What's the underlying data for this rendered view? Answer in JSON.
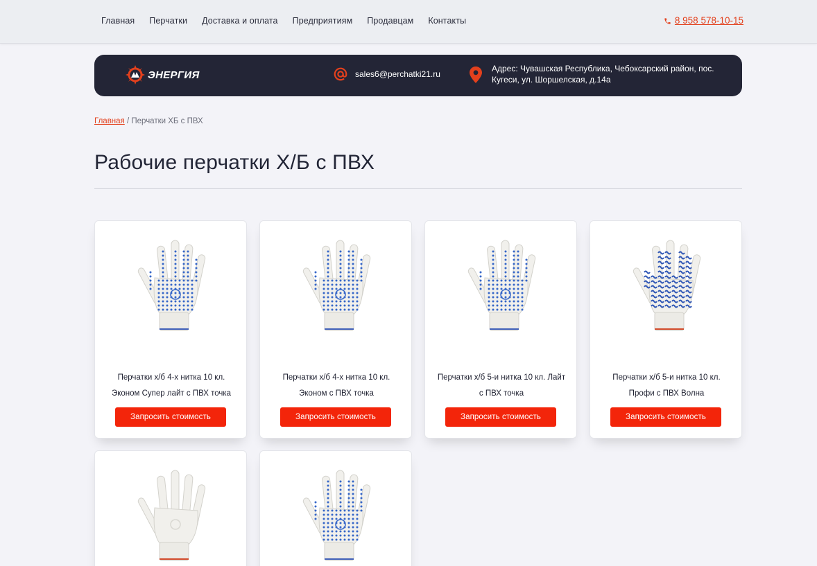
{
  "nav": {
    "items": [
      "Главная",
      "Перчатки",
      "Доставка и оплата",
      "Предприятиям",
      "Продавцам",
      "Контакты"
    ],
    "phone": "8 958 578-10-15",
    "phone_icon": "phone-icon"
  },
  "header": {
    "logo_text": "ЭНЕРГИЯ",
    "email": "sales6@perchatki21.ru",
    "email_icon": "at-sign-icon",
    "address": "Адрес: Чувашская Республика, Чебоксарский район, пос. Кугеси, ул. Шоршелская, д.14а",
    "address_icon": "location-pin-icon"
  },
  "breadcrumb": {
    "home": "Главная",
    "separator": "/",
    "current": "Перчатки ХБ с ПВХ"
  },
  "page": {
    "title": "Рабочие перчатки Х/Б с ПВХ"
  },
  "products": [
    {
      "name": "Перчатки х/б 4-х нитка 10 кл. Эконом Супер лайт с ПВХ точка",
      "button": "Запросить стоимость",
      "pattern": "dots-blue"
    },
    {
      "name": "Перчатки х/б 4-х нитка 10 кл. Эконом с ПВХ точка",
      "button": "Запросить стоимость",
      "pattern": "dots-blue"
    },
    {
      "name": "Перчатки х/б 5-и нитка 10 кл. Лайт с ПВХ точка",
      "button": "Запросить стоимость",
      "pattern": "dots-blue"
    },
    {
      "name": "Перчатки х/б 5-и нитка 10 кл. Профи с ПВХ Волна",
      "button": "Запросить стоимость",
      "pattern": "wave-blue"
    },
    {
      "name": "",
      "button": "",
      "pattern": "plain-white"
    },
    {
      "name": "",
      "button": "",
      "pattern": "dots-blue"
    }
  ],
  "colors": {
    "accent": "#f3250a",
    "link": "#e3401d",
    "header_band": "#232536",
    "page_bg": "#f3f3f8"
  }
}
